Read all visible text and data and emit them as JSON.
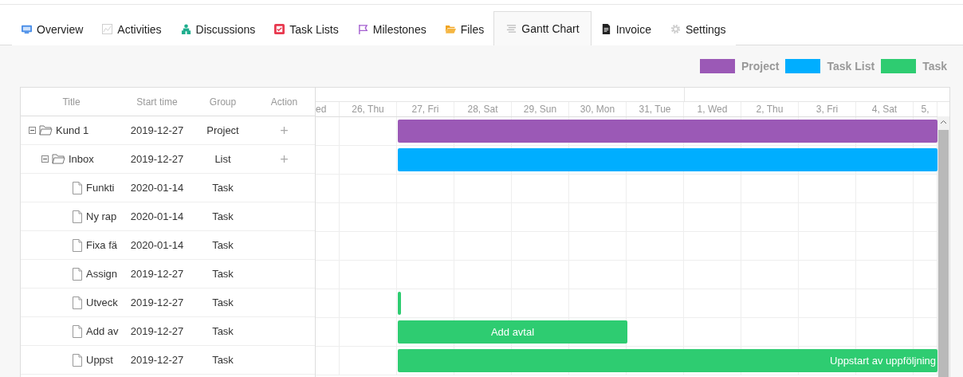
{
  "tabs": [
    {
      "label": "Overview",
      "selected": false
    },
    {
      "label": "Activities",
      "selected": false
    },
    {
      "label": "Discussions",
      "selected": false
    },
    {
      "label": "Task Lists",
      "selected": false
    },
    {
      "label": "Milestones",
      "selected": false
    },
    {
      "label": "Files",
      "selected": false
    },
    {
      "label": "Gantt Chart",
      "selected": true
    },
    {
      "label": "Invoice",
      "selected": false
    },
    {
      "label": "Settings",
      "selected": false
    }
  ],
  "legend": [
    {
      "label": "Project",
      "color": "#9b59b6"
    },
    {
      "label": "Task List",
      "color": "#00aeff"
    },
    {
      "label": "Task",
      "color": "#2ecc71"
    }
  ],
  "table": {
    "columns": [
      "Title",
      "Start time",
      "Group",
      "Action"
    ],
    "rows": [
      {
        "kind": "project",
        "title": "Kund 1",
        "start": "2019-12-27",
        "group": "Project",
        "action": "+",
        "expanded": true,
        "bar": true
      },
      {
        "kind": "list",
        "title": "Inbox",
        "start": "2019-12-27",
        "group": "List",
        "action": "+",
        "expanded": true,
        "bar": true
      },
      {
        "kind": "task",
        "title": "Funkti",
        "start": "2020-01-14",
        "group": "Task",
        "bar": false
      },
      {
        "kind": "task",
        "title": "Ny rap",
        "start": "2020-01-14",
        "group": "Task",
        "bar": false
      },
      {
        "kind": "task",
        "title": "Fixa fä",
        "start": "2020-01-14",
        "group": "Task",
        "bar": false
      },
      {
        "kind": "task",
        "title": "Assign",
        "start": "2019-12-27",
        "group": "Task",
        "bar": false
      },
      {
        "kind": "task",
        "title": "Utveck",
        "start": "2019-12-27",
        "group": "Task",
        "bar": true
      },
      {
        "kind": "task",
        "title": "Add av",
        "start": "2019-12-27",
        "group": "Task",
        "bar": true,
        "bar_label": "Add avtal"
      },
      {
        "kind": "task",
        "title": "Uppst",
        "start": "2019-12-27",
        "group": "Task",
        "bar": true,
        "bar_label": "Uppstart av uppföljning"
      }
    ]
  },
  "timeline": {
    "days": [
      "ed",
      "26, Thu",
      "27, Fri",
      "28, Sat",
      "29, Sun",
      "30, Mon",
      "31, Tue",
      "1, Wed",
      "2, Thu",
      "3, Fri",
      "4, Sat",
      "5,"
    ]
  }
}
